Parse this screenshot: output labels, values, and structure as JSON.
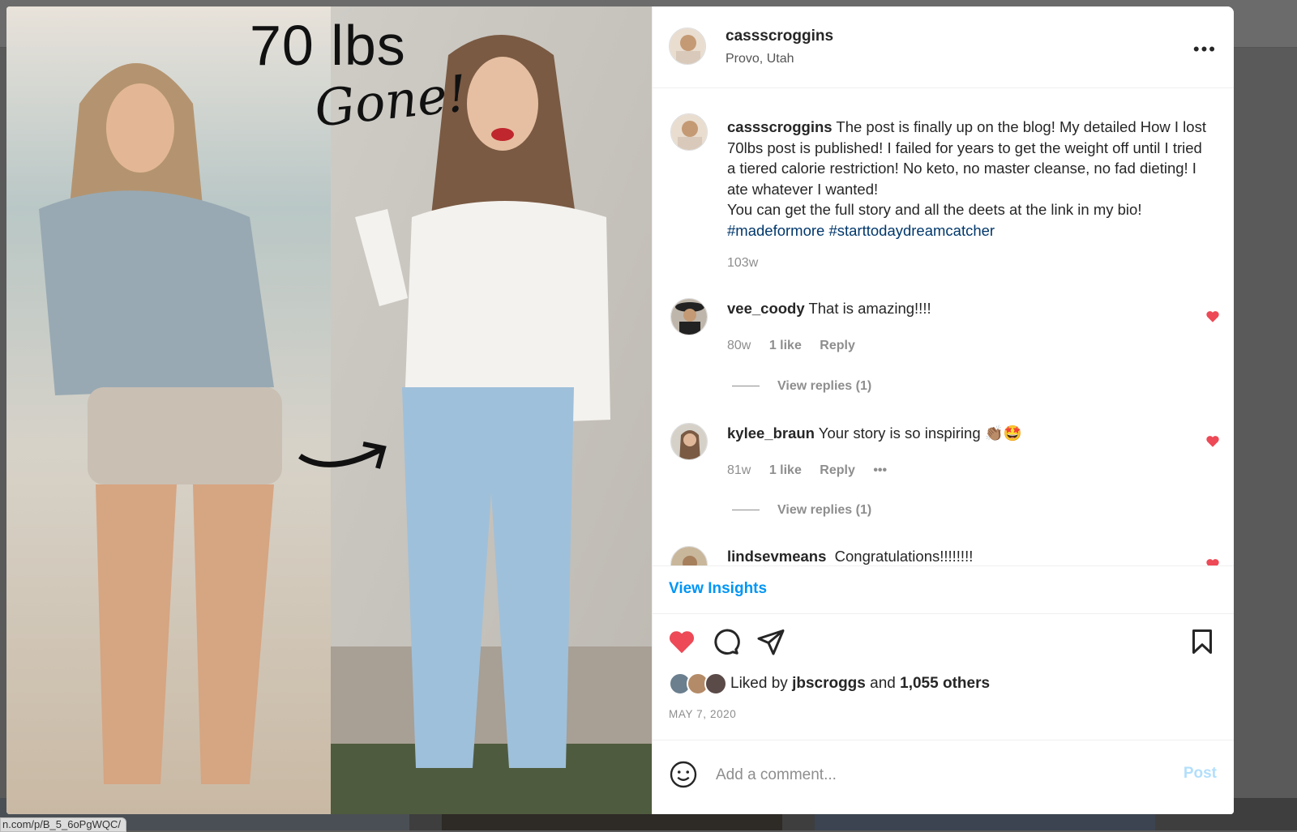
{
  "status_url": "n.com/p/B_5_6oPgWQC/",
  "photo": {
    "headline": "70 lbs",
    "script_text": "Gone!"
  },
  "post": {
    "username": "cassscroggins",
    "location": "Provo, Utah",
    "caption": {
      "username": "cassscroggins",
      "text": "The post is finally up on the blog! My detailed How I lost 70lbs post is published! I failed for years to get the weight off until I tried a tiered calorie restriction! No keto, no master cleanse, no fad dieting! I ate whatever I wanted!",
      "text2": "You can get the full story and all the deets at the link in my bio!",
      "hashtag1": "#madeformore",
      "hashtag2": "#starttodaydreamcatcher",
      "time": "103w"
    },
    "comments": [
      {
        "username": "vee_coody",
        "text": "That is amazing!!!!",
        "time": "80w",
        "likes": "1 like",
        "reply": "Reply",
        "view_replies": "View replies (1)"
      },
      {
        "username": "kylee_braun",
        "text": "Your story is so inspiring 👏🏽🤩",
        "time": "81w",
        "likes": "1 like",
        "reply": "Reply",
        "more": "•••",
        "view_replies": "View replies (1)"
      },
      {
        "username": "lindsevmeans",
        "text": "Congratulations!!!!!!!!"
      }
    ],
    "view_insights": "View Insights",
    "liked_by_prefix": "Liked by",
    "liked_by_user": "jbscroggs",
    "liked_by_and": "and",
    "liked_by_others": "1,055 others",
    "date": "MAY 7, 2020",
    "add_comment_placeholder": "Add a comment...",
    "post_button": "Post",
    "more_icon": "•••"
  },
  "icons": {
    "like": "heart-filled-icon",
    "comment": "comment-icon",
    "share": "paper-plane-icon",
    "save": "bookmark-icon",
    "emoji": "smiley-icon",
    "more": "ellipsis-icon"
  },
  "colors": {
    "like_red": "#ed4956",
    "link_blue": "#0095f6",
    "hashtag": "#00376b",
    "post_disabled": "#b2dffc"
  }
}
